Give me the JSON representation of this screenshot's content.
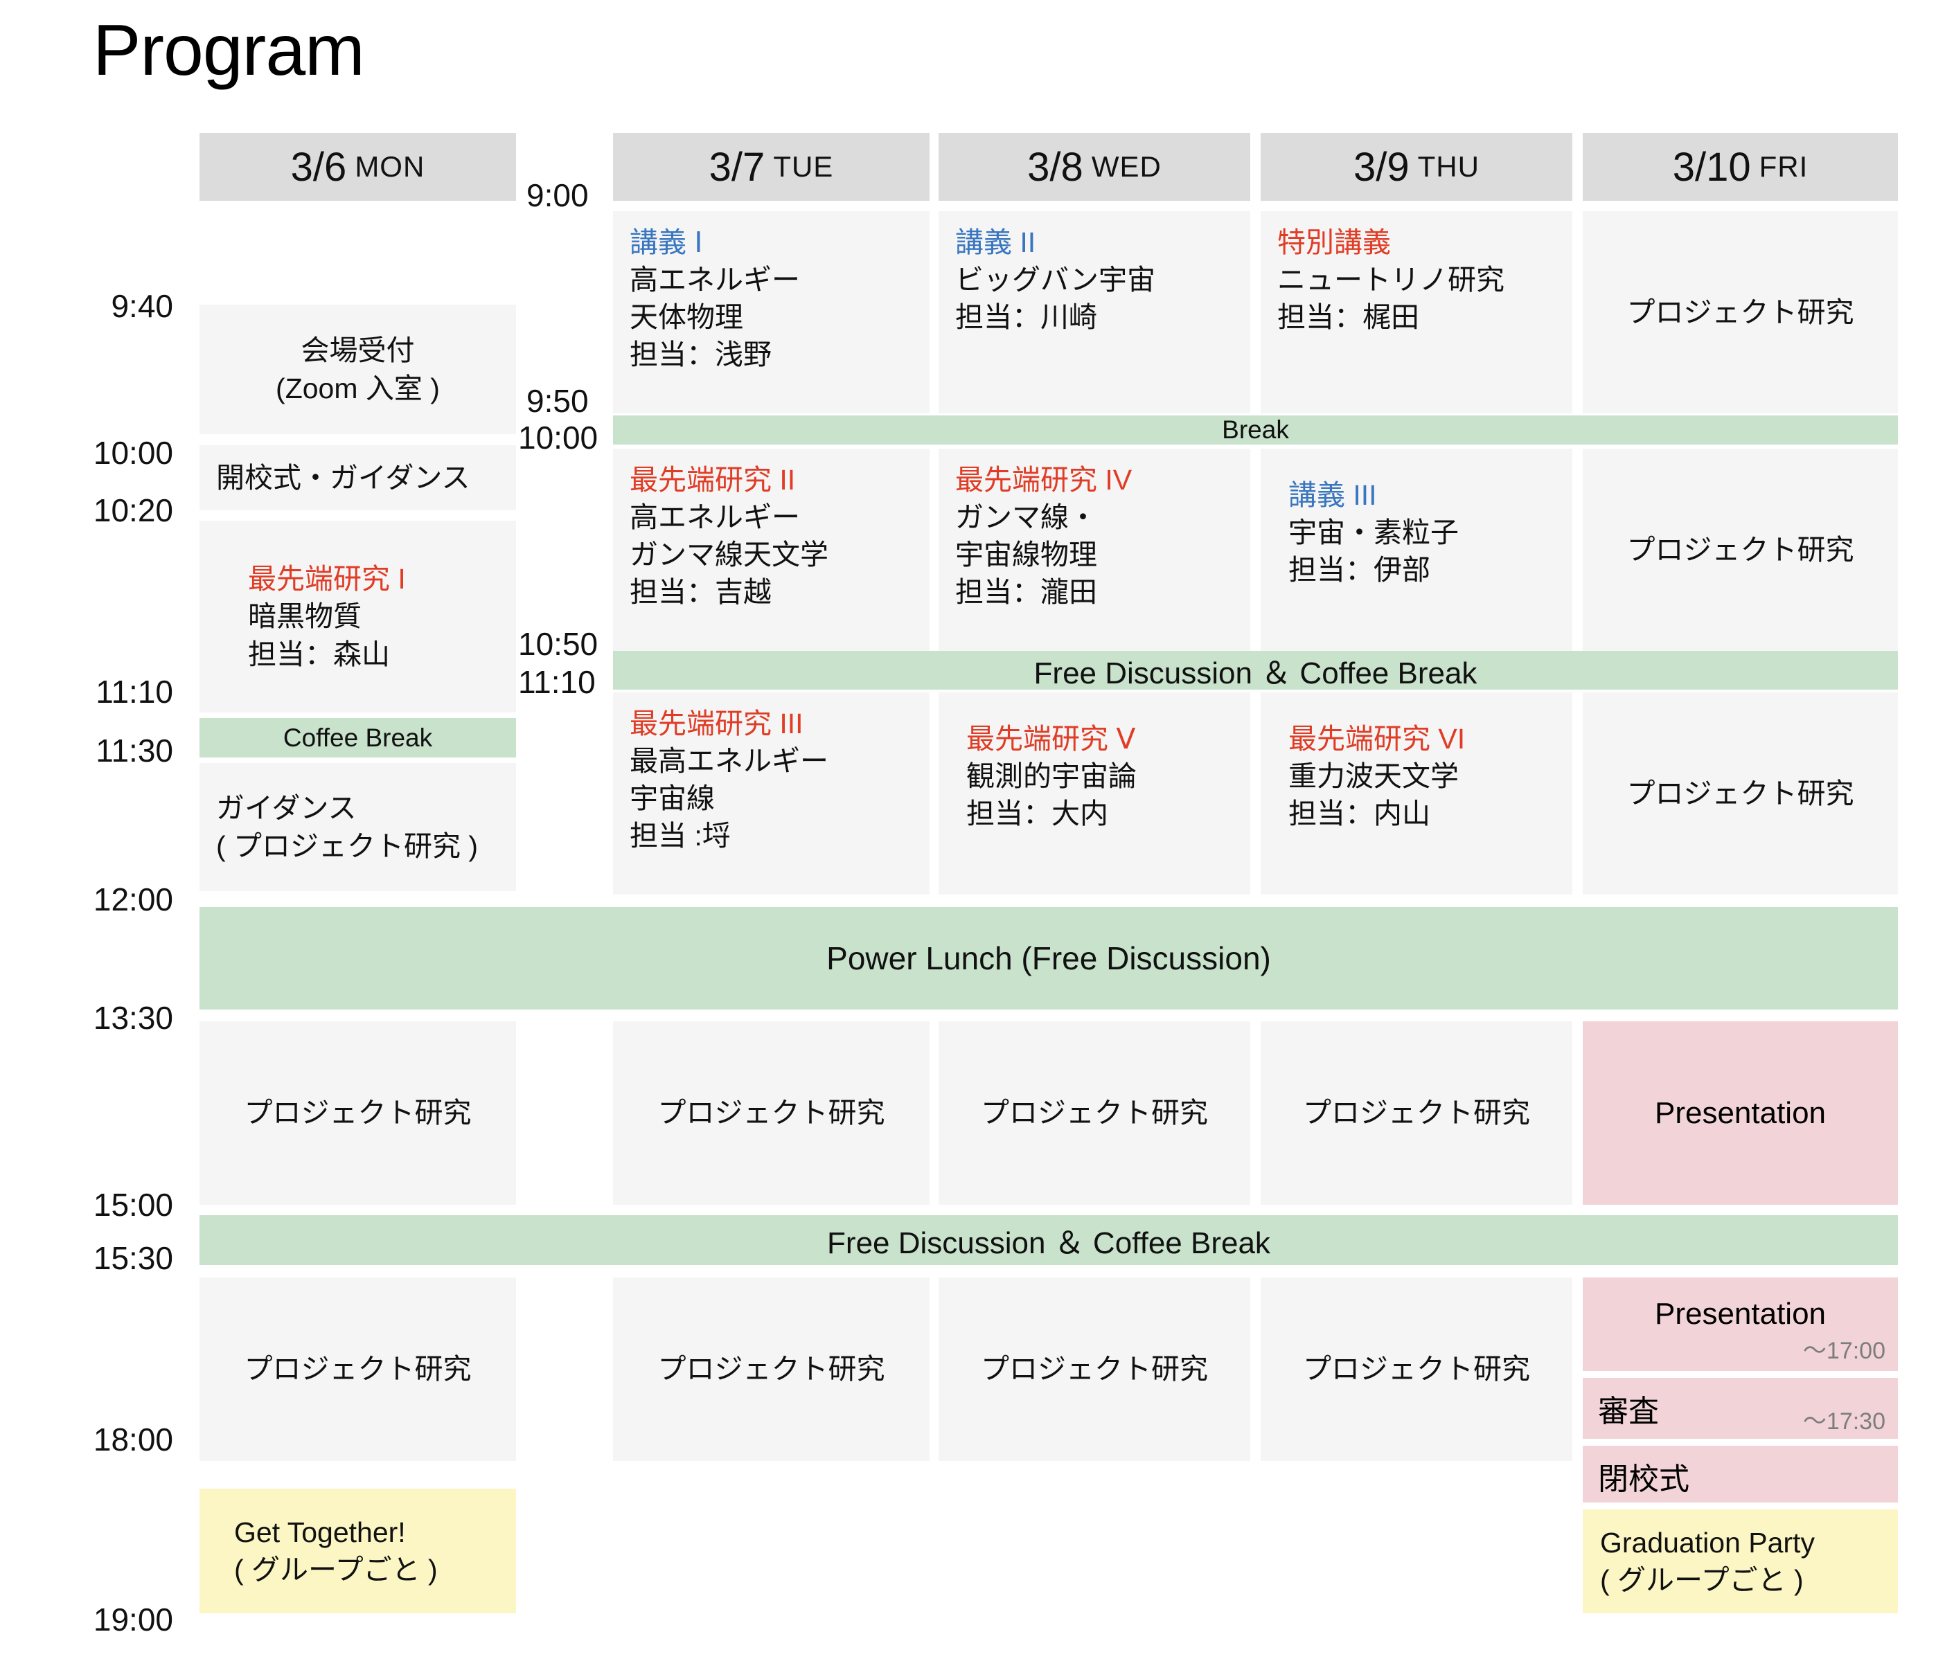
{
  "title": "Program",
  "days": [
    {
      "num": "3/6",
      "dow": "MON"
    },
    {
      "num": "3/7",
      "dow": "TUE"
    },
    {
      "num": "3/8",
      "dow": "WED"
    },
    {
      "num": "3/9",
      "dow": "THU"
    },
    {
      "num": "3/10",
      "dow": "FRI"
    }
  ],
  "times_left": [
    "9:40",
    "10:00",
    "10:20",
    "11:10",
    "11:30",
    "12:00",
    "13:30",
    "15:00",
    "15:30",
    "18:00",
    "19:00"
  ],
  "times_mid": [
    "9:00",
    "9:50",
    "10:00",
    "10:50",
    "11:10"
  ],
  "colors": {
    "header_bg": "#dcdcdc",
    "cell_bg": "#f4f5f4",
    "break_green": "#c8e2cc",
    "presentation_pink": "#f2d4d8",
    "party_yellow": "#fbf6c4",
    "lecture_blue": "#3a76c0",
    "research_red": "#e03c26",
    "subtime_gray": "#7d7d7d"
  },
  "mon": {
    "reception": {
      "l1": "会場受付",
      "l2": "(Zoom 入室 )"
    },
    "opening": "開校式・ガイダンス",
    "research1": {
      "title": "最先端研究 I",
      "l1": "暗黒物質",
      "l2": "担当：森山"
    },
    "coffee": "Coffee Break",
    "guidance": {
      "l1": "ガイダンス",
      "l2": "( プロジェクト研究 )"
    },
    "pm1": "プロジェクト研究",
    "pm2": "プロジェクト研究",
    "evening": {
      "l1": "Get Together!",
      "l2": "( グループごと )"
    }
  },
  "tue": {
    "am1": {
      "title": "講義 Ⅰ",
      "title_color": "blue",
      "l1": "高エネルギー",
      "l2": "天体物理",
      "l3": "担当：浅野"
    },
    "am2": {
      "title": "最先端研究 II",
      "title_color": "red",
      "l1": "高エネルギー",
      "l2": "ガンマ線天文学",
      "l3": "担当：吉越"
    },
    "am3": {
      "title": "最先端研究 III",
      "title_color": "red",
      "l1": "最高エネルギー",
      "l2": "宇宙線",
      "l3": "担当 :埒"
    },
    "pm1": "プロジェクト研究",
    "pm2": "プロジェクト研究"
  },
  "wed": {
    "am1": {
      "title": "講義 II",
      "title_color": "blue",
      "l1": "ビッグバン宇宙",
      "l2": "担当：川崎"
    },
    "am2": {
      "title": "最先端研究 IV",
      "title_color": "red",
      "l1": "ガンマ線・",
      "l2": "宇宙線物理",
      "l3": "担当：瀧田"
    },
    "am3": {
      "title": "最先端研究 Ⅴ",
      "title_color": "red",
      "l1": "観測的宇宙論",
      "l2": "担当：大内"
    },
    "pm1": "プロジェクト研究",
    "pm2": "プロジェクト研究"
  },
  "thu": {
    "am1": {
      "title": "特別講義",
      "title_color": "red",
      "l1": "ニュートリノ研究",
      "l2": "担当：梶田"
    },
    "am2": {
      "title": "講義 III",
      "title_color": "blue",
      "l1": "宇宙・素粒子",
      "l2": "担当：伊部"
    },
    "am3": {
      "title": "最先端研究 VI",
      "title_color": "red",
      "l1": "重力波天文学",
      "l2": "担当：内山"
    },
    "pm1": "プロジェクト研究",
    "pm2": "プロジェクト研究"
  },
  "fri": {
    "am1": "プロジェクト研究",
    "am2": "プロジェクト研究",
    "am3": "プロジェクト研究",
    "presentation_pm": "Presentation",
    "presentation2": {
      "label": "Presentation",
      "end": "〜17:00"
    },
    "review": {
      "label": "審査",
      "end": "〜17:30"
    },
    "closing": "閉校式",
    "evening": {
      "l1": "Graduation Party",
      "l2": "( グループごと )"
    }
  },
  "bands": {
    "break": "Break",
    "free_discussion_am": "Free Discussion ＆ Coffee Break",
    "power_lunch": "Power Lunch (Free Discussion)",
    "free_discussion_pm": "Free Discussion ＆ Coffee Break"
  }
}
